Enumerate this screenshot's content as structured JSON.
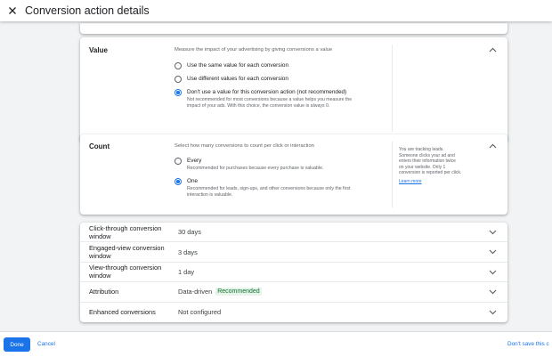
{
  "header": {
    "title": "Conversion action details",
    "close_icon": "close-icon"
  },
  "value_section": {
    "title": "Value",
    "description": "Measure the impact of your advertising by giving conversions a value",
    "options": [
      {
        "label": "Use the same value for each conversion",
        "selected": false
      },
      {
        "label": "Use different values for each conversion",
        "selected": false
      },
      {
        "label": "Don't use a value for this conversion action (not recommended)",
        "selected": true,
        "sub_line1": "Not recommended for most conversions because a value helps you measure the",
        "sub_line2": "impact of your ads. With this choice, the conversion value is always 0."
      }
    ]
  },
  "count_section": {
    "title": "Count",
    "description": "Select how many conversions to count per click or interaction",
    "options": [
      {
        "label": "Every",
        "selected": false,
        "sub_line1": "Recommended for purchases because every purchase is valuable."
      },
      {
        "label": "One",
        "selected": true,
        "sub_line1": "Recommended for leads, sign-ups, and other conversions because only the first",
        "sub_line2": "interaction is valuable."
      }
    ],
    "side_note": {
      "line1": "You are tracking leads.",
      "line2": "Someone clicks your ad and",
      "line3": "enters their information twice",
      "line4": "on your website. Only 1",
      "line5": "conversion is reported per click.",
      "link": "Learn more"
    }
  },
  "settings_rows": [
    {
      "label_line1": "Click-through conversion",
      "label_line2": "window",
      "value": "30 days"
    },
    {
      "label_line1": "Engaged-view conversion",
      "label_line2": "window",
      "value": "3 days"
    },
    {
      "label_line1": "View-through conversion",
      "label_line2": "window",
      "value": "1 day"
    },
    {
      "label_line1": "Attribution",
      "label_line2": "",
      "value": "Data-driven",
      "badge": "Recommended"
    },
    {
      "label_line1": "Enhanced conversions",
      "label_line2": "",
      "value": "Not configured"
    }
  ],
  "footer": {
    "done": "Done",
    "cancel": "Cancel",
    "dont_save": "Don't save this c"
  },
  "colors": {
    "primary_blue": "#1a73e8",
    "recommended_bg": "#e6f4ea",
    "recommended_text": "#137333"
  }
}
